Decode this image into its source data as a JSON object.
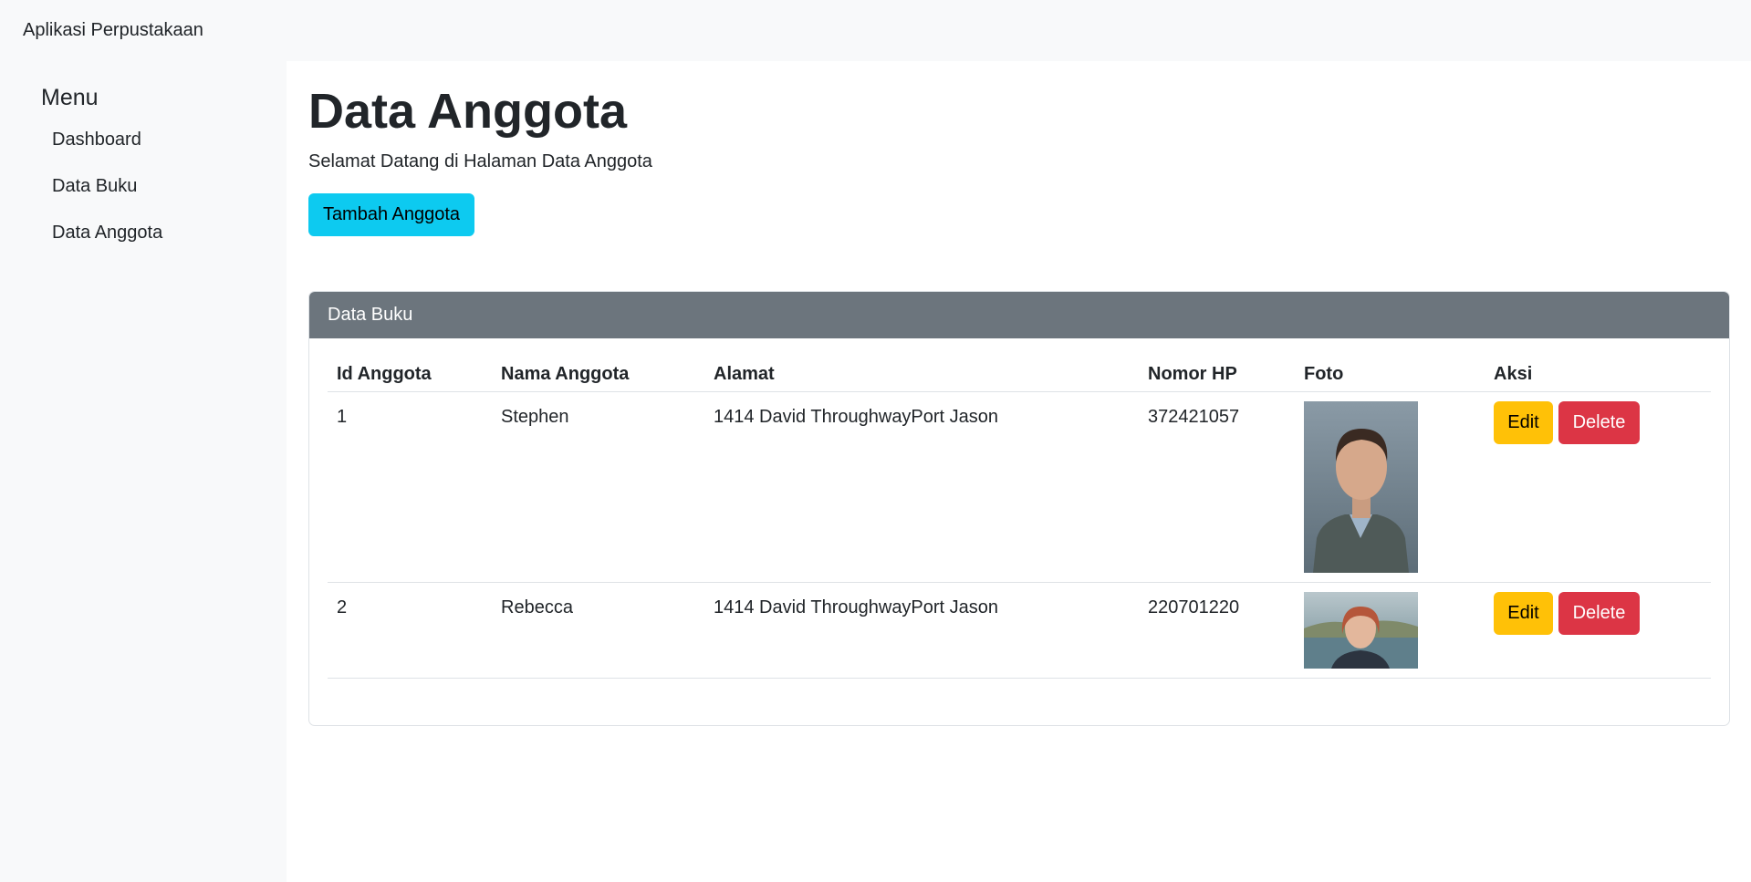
{
  "app": {
    "brand": "Aplikasi Perpustakaan"
  },
  "sidebar": {
    "heading": "Menu",
    "items": [
      {
        "label": "Dashboard"
      },
      {
        "label": "Data Buku"
      },
      {
        "label": "Data Anggota"
      }
    ]
  },
  "main": {
    "title": "Data Anggota",
    "subtitle": "Selamat Datang di Halaman Data Anggota",
    "add_button": "Tambah Anggota",
    "card_title": "Data Buku",
    "columns": [
      "Id Anggota",
      "Nama Anggota",
      "Alamat",
      "Nomor HP",
      "Foto",
      "Aksi"
    ],
    "rows": [
      {
        "id": "1",
        "nama": "Stephen",
        "alamat": "1414 David ThroughwayPort Jason",
        "hp": "372421057",
        "edit": "Edit",
        "delete": "Delete"
      },
      {
        "id": "2",
        "nama": "Rebecca",
        "alamat": "1414 David ThroughwayPort Jason",
        "hp": "220701220",
        "edit": "Edit",
        "delete": "Delete"
      }
    ]
  },
  "colors": {
    "navbar_bg": "#f8f9fa",
    "card_header_bg": "#6c757d",
    "info": "#0dcaf0",
    "warning": "#ffc107",
    "danger": "#dc3545"
  }
}
